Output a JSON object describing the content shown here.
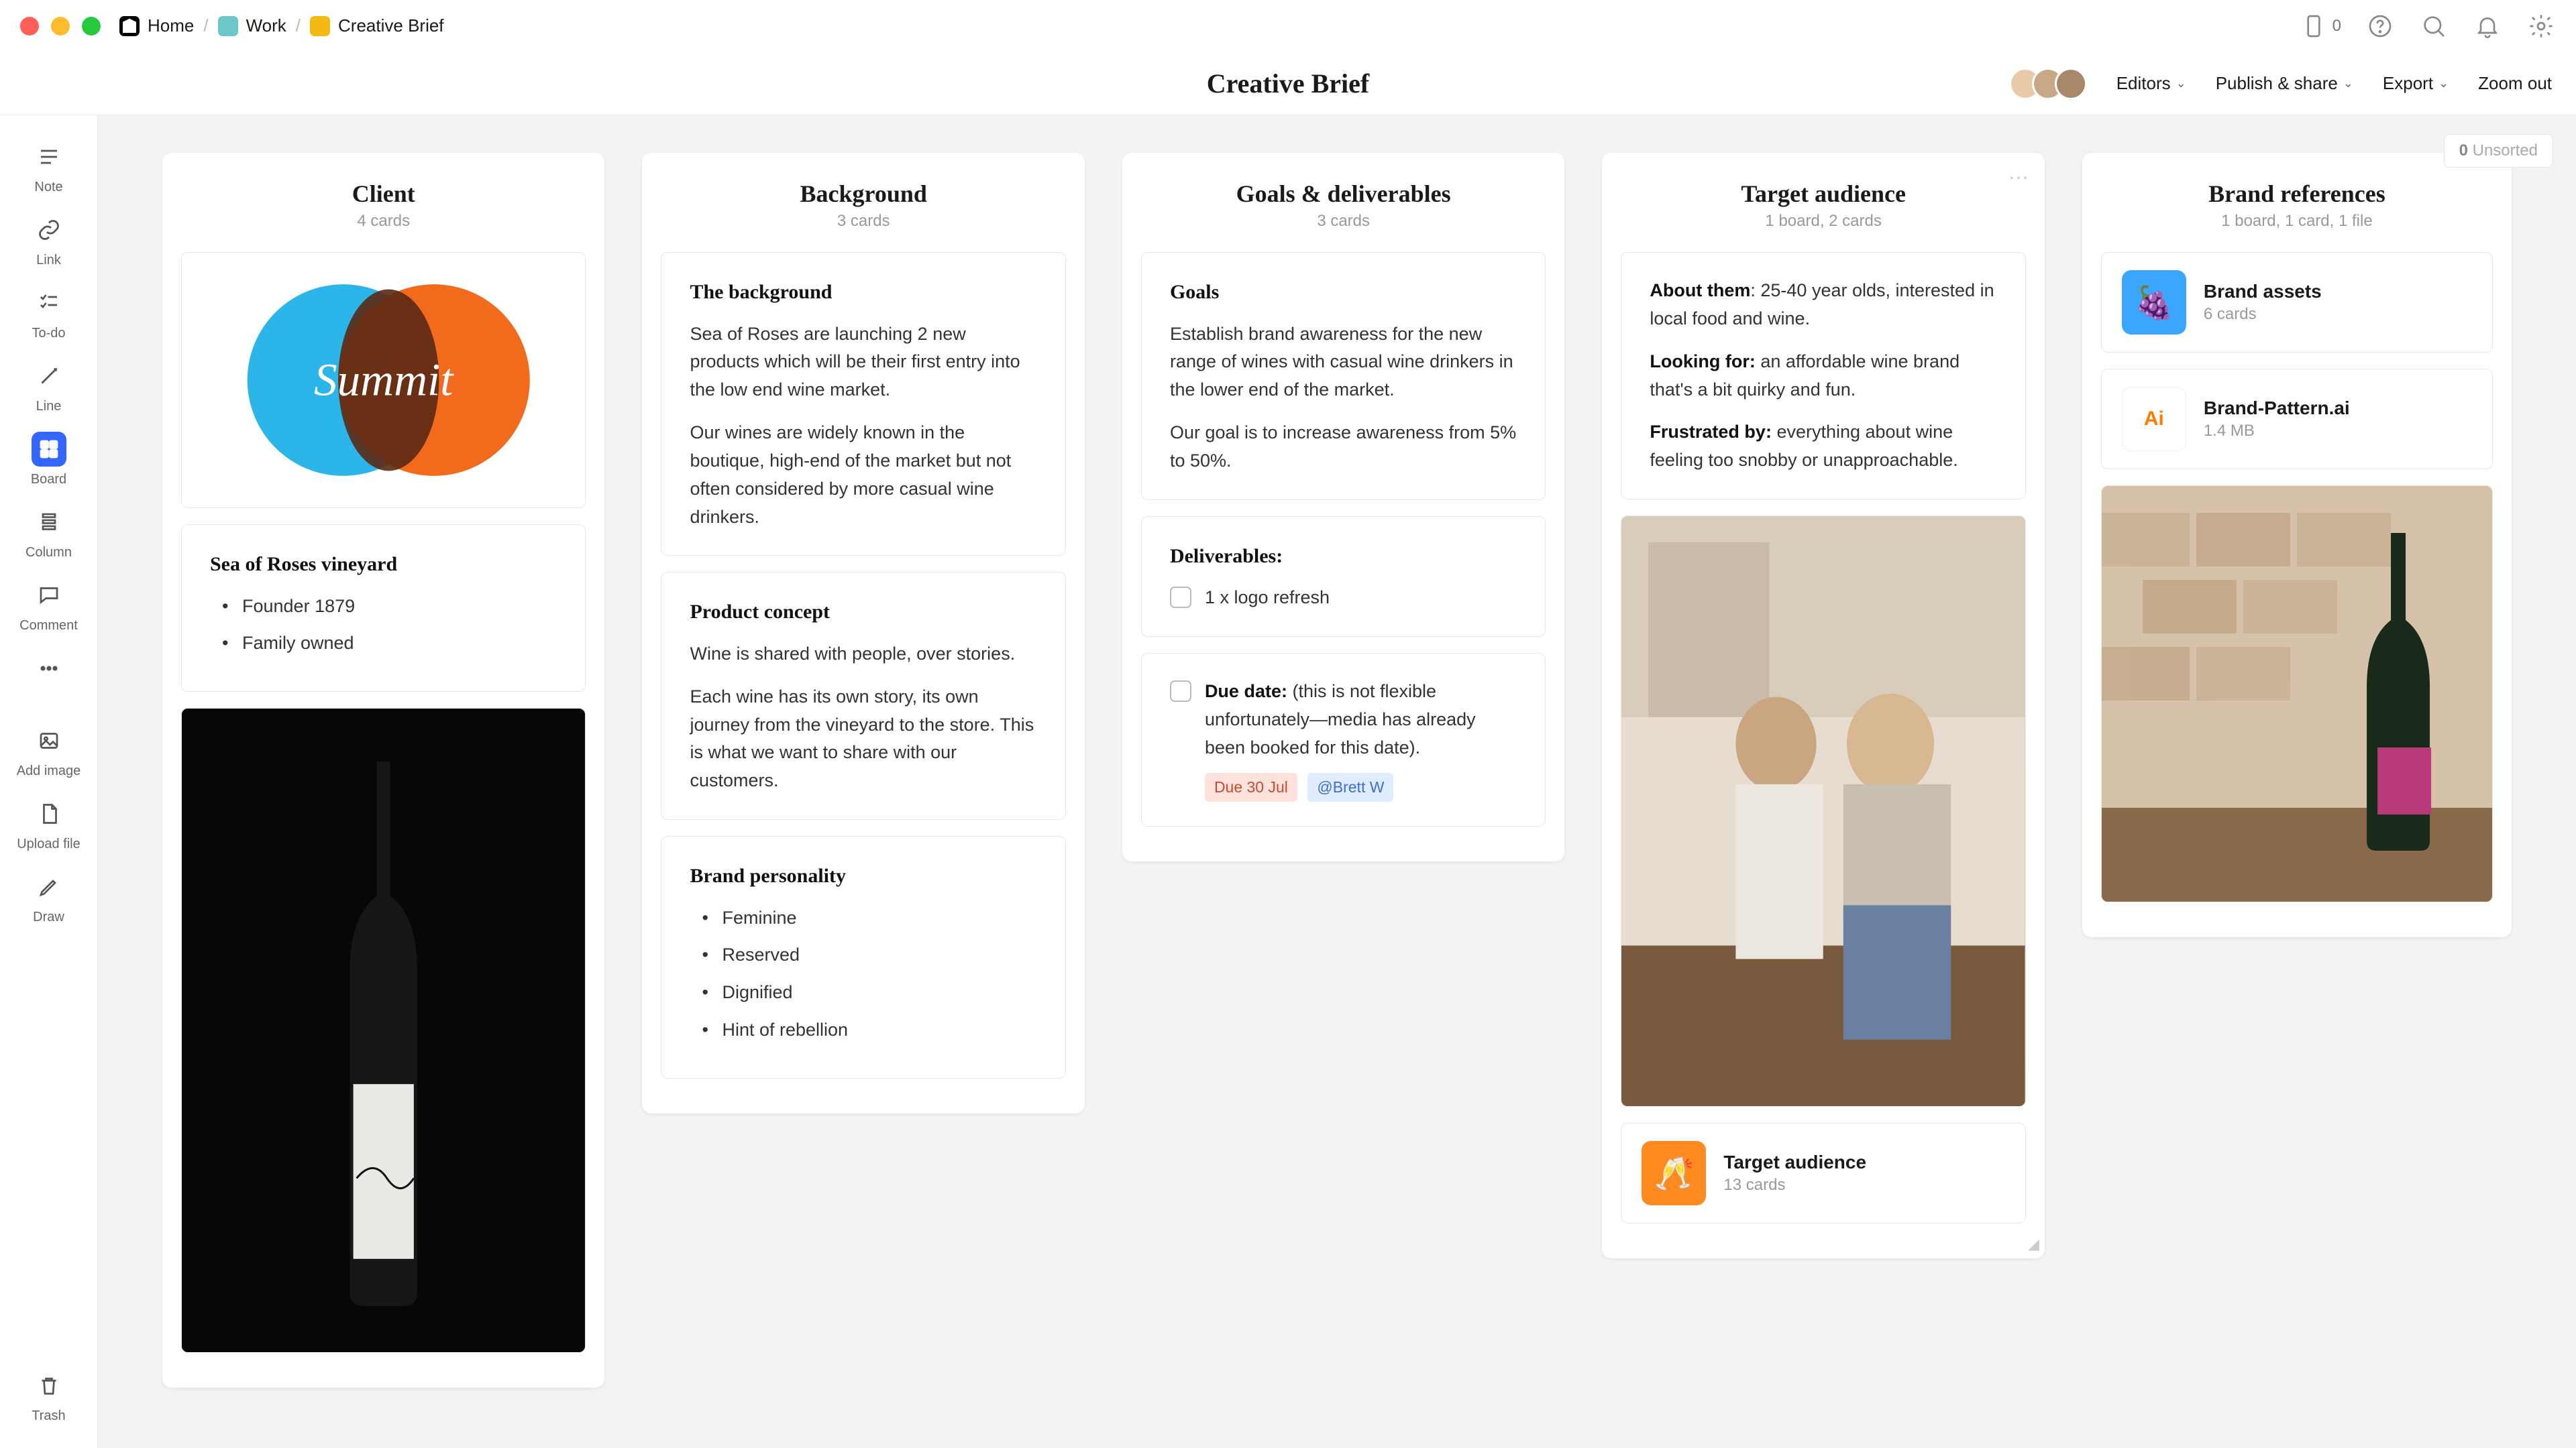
{
  "breadcrumb": {
    "home": "Home",
    "work": "Work",
    "page": "Creative Brief"
  },
  "titlebar": {
    "mobile_count": "0"
  },
  "header": {
    "title": "Creative Brief",
    "editors": "Editors",
    "publish": "Publish & share",
    "export": "Export",
    "zoom_out": "Zoom out"
  },
  "sidebar": {
    "note": "Note",
    "link": "Link",
    "todo": "To-do",
    "line": "Line",
    "board": "Board",
    "column": "Column",
    "comment": "Comment",
    "add_image": "Add image",
    "upload_file": "Upload file",
    "draw": "Draw",
    "trash": "Trash"
  },
  "unsorted": {
    "count": "0",
    "label": "Unsorted"
  },
  "columns": {
    "client": {
      "title": "Client",
      "sub": "4 cards",
      "vineyard_title": "Sea of Roses vineyard",
      "vineyard_items": {
        "a": "Founder 1879",
        "b": "Family owned"
      }
    },
    "background": {
      "title": "Background",
      "sub": "3 cards",
      "bg_h": "The background",
      "bg_p1": "Sea of Roses are launching 2 new products which will be their first entry into the low end wine market.",
      "bg_p2": "Our wines are widely known in the boutique, high-end of the market but not often considered by more casual wine drinkers.",
      "pc_h": "Product concept",
      "pc_p1": "Wine is shared with people, over stories.",
      "pc_p2": "Each wine has its own story, its own journey from the vineyard to the store. This is what we want to share with our customers.",
      "bp_h": "Brand personality",
      "bp_items": {
        "a": "Feminine",
        "b": "Reserved",
        "c": "Dignified",
        "d": "Hint of rebellion"
      }
    },
    "goals": {
      "title": "Goals & deliverables",
      "sub": "3 cards",
      "g_h": "Goals",
      "g_p1": "Establish brand awareness for the new range of wines with casual wine drinkers in the lower end of the market.",
      "g_p2": "Our goal is to increase awareness from 5% to 50%.",
      "d_h": "Deliverables:",
      "d_item": "1 x logo refresh",
      "due_label": "Due date:",
      "due_text": " (this is not flexible unfortunately—media has already been booked for this date).",
      "due_tag": "Due 30 Jul",
      "mention": "@Brett W"
    },
    "audience": {
      "title": "Target audience",
      "sub": "1 board, 2 cards",
      "about_l": "About them",
      "about_t": ": 25-40 year olds, interested in local food and wine.",
      "looking_l": "Looking for:",
      "looking_t": " an affordable wine brand that's a bit quirky and fun.",
      "frust_l": "Frustrated by:",
      "frust_t": " everything about wine feeling too snobby or unapproachable.",
      "board_title": "Target audience",
      "board_sub": "13 cards"
    },
    "brand": {
      "title": "Brand references",
      "sub": "1 board, 1 card, 1 file",
      "assets_title": "Brand assets",
      "assets_sub": "6 cards",
      "file_title": "Brand-Pattern.ai",
      "file_sub": "1.4 MB"
    }
  }
}
